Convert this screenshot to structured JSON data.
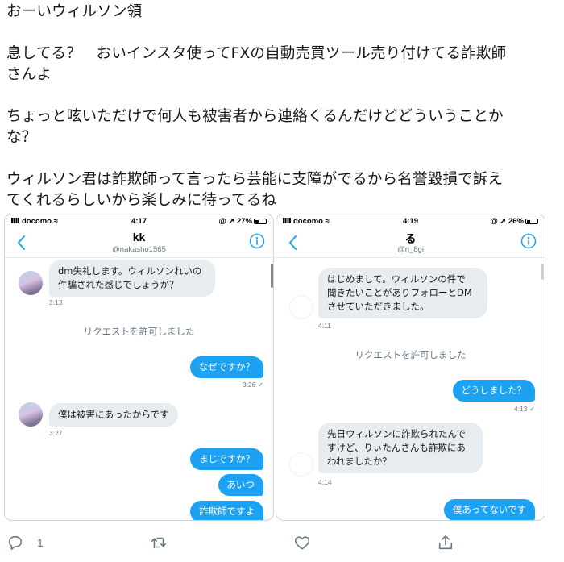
{
  "tweet": {
    "lines": [
      "おーいウィルソン領",
      "",
      "息してる？　おいインスタ使ってFXの自動売買ツール売り付けてる詐欺師",
      "さんよ",
      "",
      "ちょっと呟いただけで何人も被害者から連絡くるんだけどどういうことか",
      "な？",
      "",
      "ウィルソン君は詐欺師って言ったら芸能に支障がでるから名誉毀損で訴え",
      "てくれるらしいから楽しみに待ってるね"
    ]
  },
  "screenshots": {
    "left": {
      "status": {
        "carrier": "docomo",
        "time": "4:17",
        "battery": "27%"
      },
      "header": {
        "name": "kk",
        "handle": "@nakasho1565"
      },
      "messages": {
        "m1": {
          "text_1": "dm失礼します。ウィルソンれいの",
          "text_2": "件騙された感じでしょうか？",
          "time": "3:13"
        },
        "system": "リクエストを許可しました",
        "m2": {
          "text": "なぜですか？",
          "time": "3:26",
          "check": "✓"
        },
        "m3": {
          "text": "僕は被害にあったからです",
          "time": "3:27"
        },
        "m4": {
          "text": "まじですか？"
        },
        "m5": {
          "text": "あいつ"
        },
        "m6": {
          "text": "詐欺師ですよ"
        }
      }
    },
    "right": {
      "status": {
        "carrier": "docomo",
        "time": "4:19",
        "battery": "26%"
      },
      "header": {
        "name": "る",
        "handle": "@ri_8gi"
      },
      "messages": {
        "m1": {
          "text_1": "はじめまして。ウィルソンの件で",
          "text_2": "聞きたいことがありフォローとDM",
          "text_3": "させていただきました。",
          "time": "4:11"
        },
        "system": "リクエストを許可しました",
        "m2": {
          "text": "どうしました？",
          "time": "4:13",
          "check": "✓"
        },
        "m3": {
          "text_1": "先日ウィルソンに詐欺られたんで",
          "text_2": "すけど、りぃたんさんも詐欺にあ",
          "text_3": "われましたか？",
          "time": "4:14"
        },
        "m4": {
          "text": "僕あってないです"
        }
      }
    }
  },
  "actions": {
    "reply_count": "1"
  },
  "colors": {
    "accent": "#1da1f2",
    "incoming_bubble": "#e6ecf0",
    "muted_text": "#657786"
  }
}
